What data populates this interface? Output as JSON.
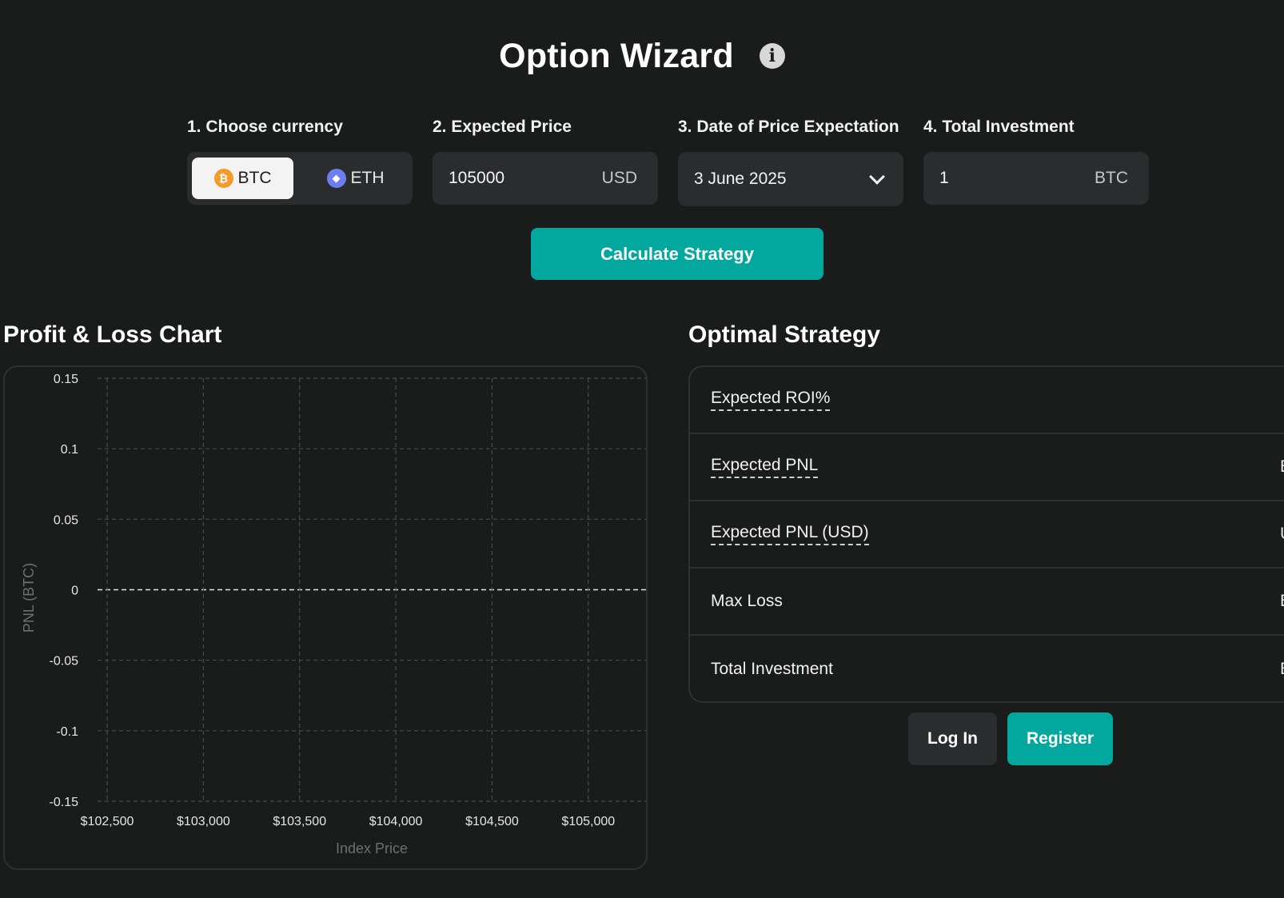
{
  "header": {
    "title": "Option Wizard",
    "info_icon": "info-icon"
  },
  "form": {
    "currency": {
      "label": "1. Choose currency",
      "options": [
        {
          "label": "BTC",
          "icon": "bitcoin-icon",
          "selected": true
        },
        {
          "label": "ETH",
          "icon": "ethereum-icon",
          "selected": false
        }
      ]
    },
    "expected_price": {
      "label": "2. Expected Price",
      "value": "105000",
      "unit": "USD"
    },
    "date": {
      "label": "3. Date of Price Expectation",
      "value": "3 June 2025"
    },
    "total_investment": {
      "label": "4. Total Investment",
      "value": "1",
      "unit": "BTC"
    },
    "calculate_label": "Calculate Strategy"
  },
  "pnl_chart": {
    "section_title": "Profit & Loss Chart"
  },
  "chart_data": {
    "type": "line",
    "title": "",
    "xlabel": "Index Price",
    "ylabel": "PNL (BTC)",
    "x_ticks": [
      "$102,500",
      "$103,000",
      "$103,500",
      "$104,000",
      "$104,500",
      "$105,000"
    ],
    "x_tick_values": [
      102500,
      103000,
      103500,
      104000,
      104500,
      105000
    ],
    "y_ticks": [
      "0.15",
      "0.1",
      "0.05",
      "0",
      "-0.05",
      "-0.1",
      "-0.15"
    ],
    "y_tick_values": [
      0.15,
      0.1,
      0.05,
      0,
      -0.05,
      -0.1,
      -0.15
    ],
    "xlim": [
      102450,
      105300
    ],
    "ylim": [
      -0.15,
      0.15
    ],
    "grid": true,
    "series": []
  },
  "strategy": {
    "section_title": "Optimal Strategy",
    "rows": [
      {
        "label": "Expected ROI%",
        "value": "",
        "dotted": true
      },
      {
        "label": "Expected PNL",
        "value": "B",
        "dotted": true
      },
      {
        "label": "Expected PNL (USD)",
        "value": "U",
        "dotted": true
      },
      {
        "label": "Max Loss",
        "value": "B",
        "dotted": false
      },
      {
        "label": "Total Investment",
        "value": "B",
        "dotted": false
      }
    ]
  },
  "auth": {
    "login_label": "Log In",
    "register_label": "Register"
  },
  "colors": {
    "background": "#1a1b1b",
    "panel": "#2b2c2d",
    "accent": "#02a79e",
    "btc": "#f39c2a",
    "eth": "#6c7ff0"
  }
}
